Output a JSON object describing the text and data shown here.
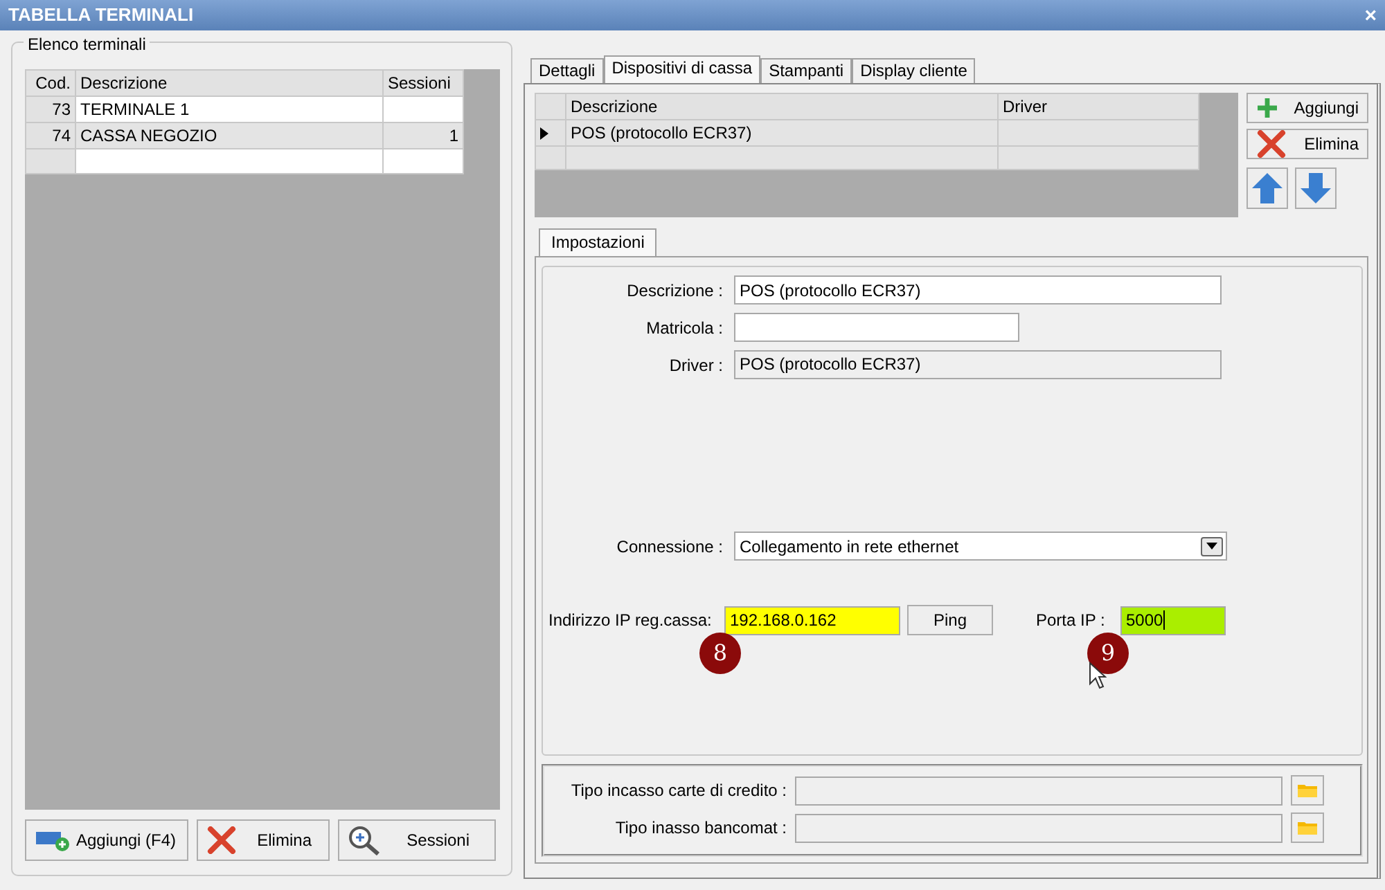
{
  "window": {
    "title": "TABELLA TERMINALI",
    "close": "×"
  },
  "terminals": {
    "legend": "Elenco terminali",
    "columns": [
      "Cod.",
      "Descrizione",
      "Sessioni"
    ],
    "rows": [
      {
        "code": "73",
        "description": "TERMINALE 1",
        "selected": false
      },
      {
        "code": "74",
        "description": "CASSA NEGOZIO",
        "sessions": "1",
        "selected": true
      }
    ]
  },
  "terminal_buttons": [
    {
      "label": "Aggiungi (F4)",
      "kind": "add-card"
    },
    {
      "label": "Elimina",
      "kind": "delete"
    },
    {
      "label": "Sessioni",
      "kind": "zoom"
    }
  ],
  "tabs": [
    {
      "label": "Dettagli",
      "selected": false
    },
    {
      "label": "Dispositivi di cassa",
      "selected": true
    },
    {
      "label": "Stampanti",
      "selected": false
    },
    {
      "label": "Display cliente",
      "selected": false
    }
  ],
  "devices": {
    "columns": [
      "Descrizione",
      "Driver"
    ],
    "rows": [
      {
        "description": "POS (protocollo ECR37)",
        "current": true
      }
    ]
  },
  "device_buttons": [
    {
      "label": "Aggiungi",
      "kind": "add"
    },
    {
      "label": "Elimina",
      "kind": "delete"
    },
    {
      "kind": "up"
    },
    {
      "kind": "down"
    }
  ],
  "subtabs": [
    {
      "label": "Impostazioni",
      "selected": true
    }
  ],
  "fields": [
    {
      "label": "Descrizione :",
      "value": "POS (protocollo ECR37)",
      "disabled": false
    },
    {
      "label": "Matricola :",
      "disabled": false
    },
    {
      "label": "Driver :",
      "value": "POS (protocollo ECR37)",
      "disabled": true
    }
  ],
  "connection": {
    "label": "Connessione :",
    "value": "Collegamento in rete ethernet"
  },
  "ip": {
    "label": "Indirizzo IP reg.cassa:",
    "value": "192.168.0.162",
    "color": "#ffff00"
  },
  "ping_button": "Ping",
  "port": {
    "label": "Porta IP :",
    "value": "5000",
    "color": "#aaee00"
  },
  "callouts": [
    {
      "number": "8"
    },
    {
      "number": "9"
    }
  ],
  "payment_fields": [
    {
      "label": "Tipo incasso carte di credito :"
    },
    {
      "label": "Tipo inasso bancomat :"
    }
  ]
}
